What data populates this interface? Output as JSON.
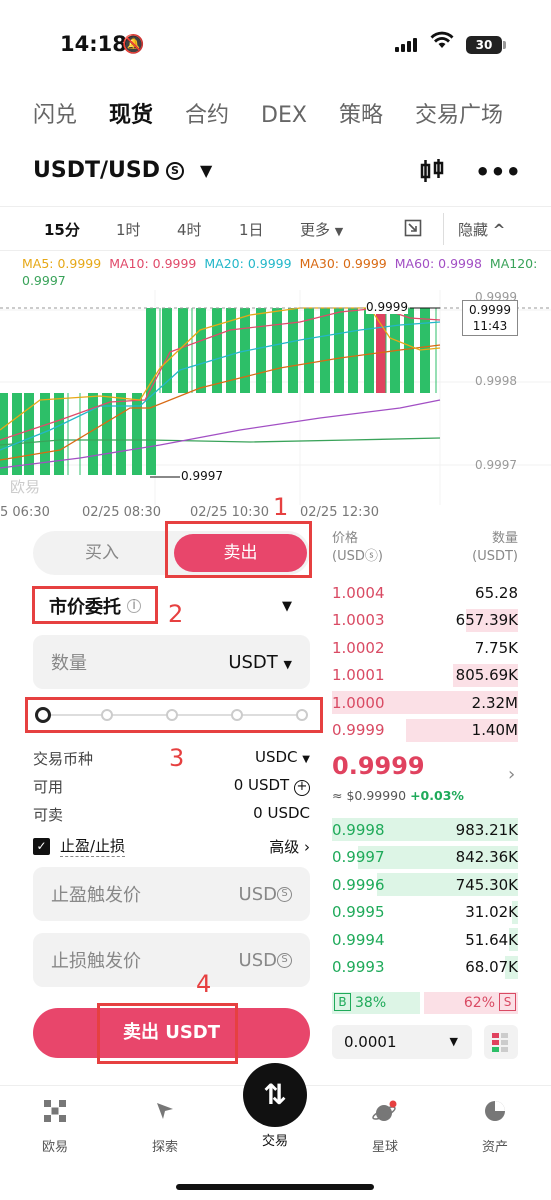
{
  "status": {
    "time": "14:18",
    "battery": "30"
  },
  "top_tabs": [
    "闪兑",
    "现货",
    "合约",
    "DEX",
    "策略",
    "交易广场"
  ],
  "active_tab_index": 1,
  "pair": {
    "name": "USDT/USD",
    "suffix": "S"
  },
  "intervals": [
    "15分",
    "1时",
    "4时",
    "1日",
    "更多"
  ],
  "hide_label": "隐藏",
  "ma_legend": [
    {
      "label": "MA5: 0.9999",
      "color": "#e6a817"
    },
    {
      "label": "MA10: 0.9999",
      "color": "#e04a6a"
    },
    {
      "label": "MA20: 0.9999",
      "color": "#23b7c9"
    },
    {
      "label": "MA30: 0.9999",
      "color": "#d86a14"
    },
    {
      "label": "MA60: 0.9998",
      "color": "#a24fc4"
    },
    {
      "label": "MA120: 0.9997",
      "color": "#3aa35a"
    }
  ],
  "chart": {
    "y_labels": [
      "0.9999",
      "0.9998",
      "0.9997"
    ],
    "price_tag": {
      "price": "0.9999",
      "countdown": "11:43"
    },
    "high_marker": "0.9999",
    "low_marker": "0.9997",
    "watermark": "欧易",
    "time_labels": [
      "5 06:30",
      "02/25 08:30",
      "02/25 10:30",
      "02/25 12:30"
    ]
  },
  "order_form": {
    "buy_label": "买入",
    "sell_label": "卖出",
    "order_type": "市价委托",
    "quantity_label": "数量",
    "quantity_unit": "USDT",
    "slider_value_percent": 0,
    "trade_currency_label": "交易币种",
    "trade_currency": "USDC",
    "available_label": "可用",
    "available_value": "0 USDT",
    "sellable_label": "可卖",
    "sellable_value": "0 USDC",
    "tpsl_label": "止盈/止损",
    "advanced_label": "高级",
    "tp_label": "止盈触发价",
    "sl_label": "止损触发价",
    "price_unit": "USD",
    "submit_label": "卖出 USDT"
  },
  "annotations": [
    "1",
    "2",
    "3",
    "4"
  ],
  "orderbook": {
    "price_header": "价格",
    "price_unit": "(USDⓢ)",
    "qty_header": "数量",
    "qty_unit": "(USDT)",
    "asks": [
      {
        "price": "1.0004",
        "qty": "65.28",
        "depth": 0.0
      },
      {
        "price": "1.0003",
        "qty": "657.39K",
        "depth": 0.28
      },
      {
        "price": "1.0002",
        "qty": "7.75K",
        "depth": 0.0
      },
      {
        "price": "1.0001",
        "qty": "805.69K",
        "depth": 0.35
      },
      {
        "price": "1.0000",
        "qty": "2.32M",
        "depth": 1.0
      },
      {
        "price": "0.9999",
        "qty": "1.40M",
        "depth": 0.6
      }
    ],
    "last_price": "0.9999",
    "last_usd": "≈ $0.99990",
    "last_change": "+0.03%",
    "bids": [
      {
        "price": "0.9998",
        "qty": "983.21K",
        "depth": 1.0
      },
      {
        "price": "0.9997",
        "qty": "842.36K",
        "depth": 0.86
      },
      {
        "price": "0.9996",
        "qty": "745.30K",
        "depth": 0.76
      },
      {
        "price": "0.9995",
        "qty": "31.02K",
        "depth": 0.03
      },
      {
        "price": "0.9994",
        "qty": "51.64K",
        "depth": 0.05
      },
      {
        "price": "0.9993",
        "qty": "68.07K",
        "depth": 0.07
      }
    ],
    "buy_tag": "B",
    "buy_ratio": "38%",
    "sell_ratio": "62%",
    "sell_tag": "S",
    "precision": "0.0001"
  },
  "bottom_nav": [
    "欧易",
    "探索",
    "交易",
    "星球",
    "资产"
  ]
}
